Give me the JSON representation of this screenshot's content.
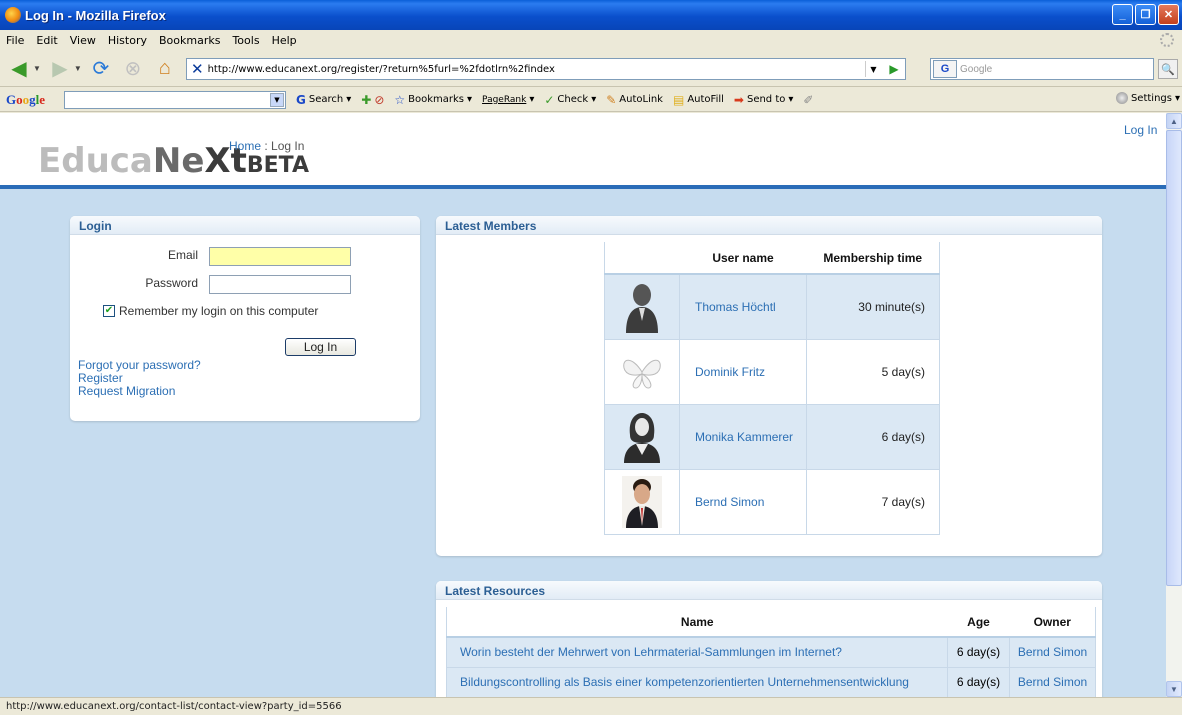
{
  "window": {
    "title": "Log In - Mozilla Firefox"
  },
  "menu": {
    "items": [
      "File",
      "Edit",
      "View",
      "History",
      "Bookmarks",
      "Tools",
      "Help"
    ]
  },
  "navbar": {
    "url": "http://www.educanext.org/register/?return%5furl=%2fdotlrn%2findex",
    "search_placeholder": "Google",
    "search_engine_icon": "G"
  },
  "google_toolbar": {
    "logo": "Google",
    "search_label": "Search",
    "bookmarks_label": "Bookmarks",
    "pagerank_label": "PageRank",
    "check_label": "Check",
    "autolink_label": "AutoLink",
    "autofill_label": "AutoFill",
    "sendto_label": "Send to",
    "settings_label": "Settings"
  },
  "site": {
    "logo_part1": "Educa",
    "logo_part2": "Ne",
    "logo_part3": "Xt",
    "logo_beta": "BETA",
    "breadcrumb_home": "Home",
    "breadcrumb_sep": " : ",
    "breadcrumb_current": "Log In",
    "top_login_link": "Log In"
  },
  "login": {
    "title": "Login",
    "email_label": "Email",
    "password_label": "Password",
    "remember_label": "Remember my login on this computer",
    "remember_checked": true,
    "button_label": "Log In",
    "forgot_link": "Forgot your password?",
    "register_link": "Register",
    "migration_link": "Request Migration"
  },
  "members": {
    "title": "Latest Members",
    "col_username": "User name",
    "col_time": "Membership time",
    "rows": [
      {
        "name": "Thomas Höchtl",
        "time": "30 minute(s)",
        "avatar": "man-silhouette"
      },
      {
        "name": "Dominik Fritz",
        "time": "5 day(s)",
        "avatar": "butterfly"
      },
      {
        "name": "Monika Kammerer",
        "time": "6 day(s)",
        "avatar": "woman-silhouette"
      },
      {
        "name": "Bernd Simon",
        "time": "7 day(s)",
        "avatar": "photo"
      }
    ]
  },
  "resources": {
    "title": "Latest Resources",
    "col_name": "Name",
    "col_age": "Age",
    "col_owner": "Owner",
    "rows": [
      {
        "name": "Worin besteht der Mehrwert von Lehrmaterial-Sammlungen im Internet?",
        "age": "6 day(s)",
        "owner": "Bernd Simon"
      },
      {
        "name": "Bildungscontrolling als Basis einer kompetenzorientierten Unternehmensentwicklung",
        "age": "6 day(s)",
        "owner": "Bernd Simon"
      }
    ]
  },
  "statusbar": {
    "text": "http://www.educanext.org/contact-list/contact-view?party_id=5566"
  },
  "colors": {
    "link": "#2c6fb4",
    "header_rule": "#2a6cb8",
    "page_bg": "#c6dcef",
    "email_field_bg": "#ffffa8"
  }
}
